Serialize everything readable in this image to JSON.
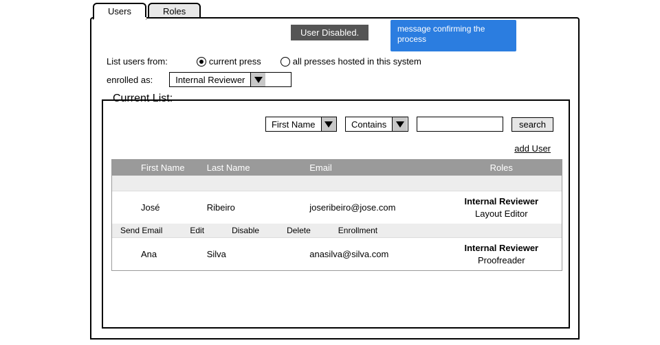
{
  "tabs": {
    "users": "Users",
    "roles": "Roles"
  },
  "notification": "User Disabled.",
  "callout": "message confirming the process",
  "filters": {
    "list_from_label": "List users from:",
    "radio_current": "current press",
    "radio_all": "all presses hosted in this system",
    "enrolled_label": "enrolled as:",
    "enrolled_value": "Internal Reviewer"
  },
  "fieldset_title": "Current List:",
  "search": {
    "field_select": "First Name",
    "match_select": "Contains",
    "button": "search"
  },
  "add_user": "add User",
  "columns": {
    "first": "First Name",
    "last": "Last Name",
    "email": "Email",
    "roles": "Roles"
  },
  "rows": [
    {
      "first": "José",
      "last": "Ribeiro",
      "email": "joseribeiro@jose.com",
      "role_primary": "Internal Reviewer",
      "role_secondary": "Layout Editor"
    },
    {
      "first": "Ana",
      "last": "Silva",
      "email": "anasilva@silva.com",
      "role_primary": "Internal Reviewer",
      "role_secondary": "Proofreader"
    }
  ],
  "row_actions": {
    "send_email": "Send Email",
    "edit": "Edit",
    "disable": "Disable",
    "delete": "Delete",
    "enrollment": "Enrollment"
  }
}
